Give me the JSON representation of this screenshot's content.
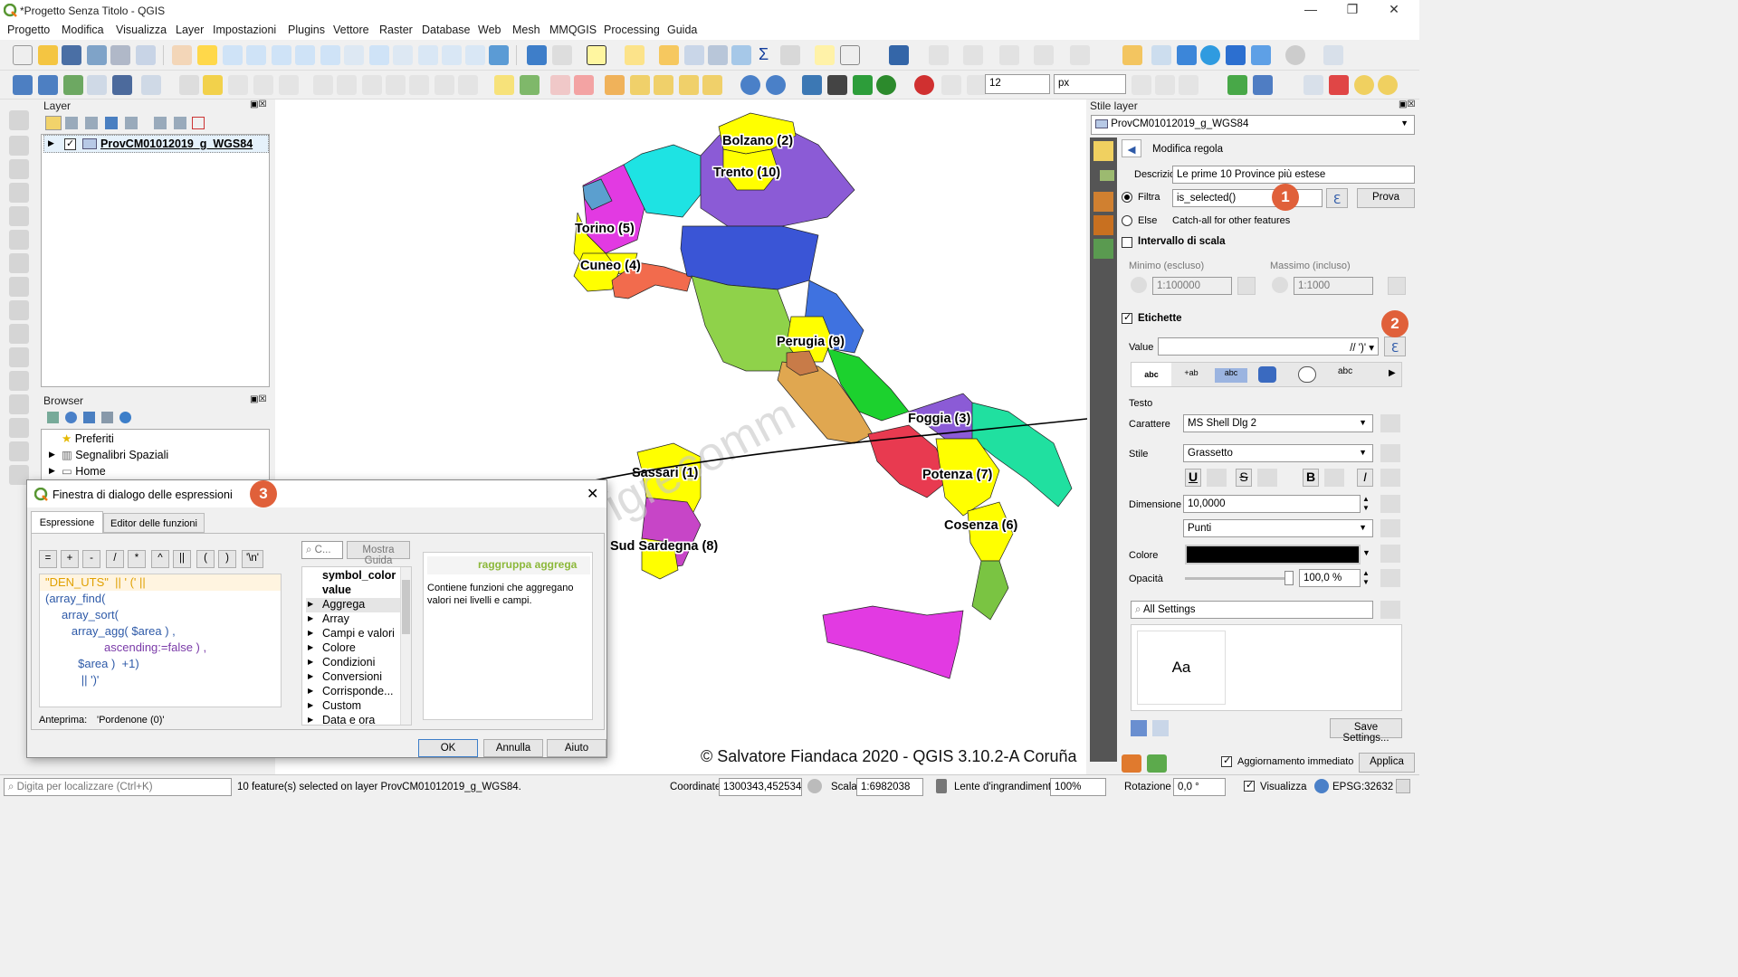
{
  "window": {
    "title": "*Progetto Senza Titolo - QGIS"
  },
  "menu": [
    "Progetto",
    "Modifica",
    "Visualizza",
    "Layer",
    "Impostazioni",
    "Plugins",
    "Vettore",
    "Raster",
    "Database",
    "Web",
    "Mesh",
    "MMQGIS",
    "Processing",
    "Guida"
  ],
  "toolbar2": {
    "size_value": "12",
    "size_unit": "px"
  },
  "layers_panel": {
    "title": "Layer",
    "layer_name": "ProvCM01012019_g_WGS84"
  },
  "browser_panel": {
    "title": "Browser",
    "items": [
      "Preferiti",
      "Segnalibri Spaziali",
      "Home"
    ]
  },
  "map": {
    "labels": [
      {
        "text": "Bolzano (2)"
      },
      {
        "text": "Trento (10)"
      },
      {
        "text": "Torino (5)"
      },
      {
        "text": "Cuneo (4)"
      },
      {
        "text": "Perugia (9)"
      },
      {
        "text": "Foggia (3)"
      },
      {
        "text": "Sassari (1)"
      },
      {
        "text": "Potenza (7)"
      },
      {
        "text": "Sud Sardegna (8)"
      },
      {
        "text": "Cosenza (6)"
      }
    ],
    "watermark": "Pigrecomm",
    "copyright": "© Salvatore Fiandaca 2020 - QGIS 3.10.2-A Coruña",
    "colors": {
      "yellow": "#ffff00",
      "cyan": "#1ee3e3",
      "purple": "#8b5bd6",
      "blue": "#3a55d6",
      "green": "#8fd24a",
      "red": "#e83a50",
      "magenta": "#e23ae2"
    }
  },
  "style_panel": {
    "title": "Stile layer",
    "layer": "ProvCM01012019_g_WGS84",
    "modifica_regola": "Modifica regola",
    "descrizione_label": "Descrizione",
    "descrizione_value": "Le prime 10 Province più estese",
    "filtra_label": "Filtra",
    "filtra_value": "is_selected()",
    "prova_button": "Prova",
    "else_label": "Else",
    "else_text": "Catch-all for other features",
    "intervallo_label": "Intervallo di scala",
    "minimo_label": "Minimo (escluso)",
    "massimo_label": "Massimo (incluso)",
    "minimo_value": "1:100000",
    "massimo_value": "1:1000",
    "etichette_label": "Etichette",
    "value_label": "Value",
    "value_text": "// ')'",
    "testo_label": "Testo",
    "carattere_label": "Carattere",
    "carattere_value": "MS Shell Dlg 2",
    "stile_label": "Stile",
    "stile_value": "Grassetto",
    "dimensione_label": "Dimensione",
    "dimensione_value": "10,0000",
    "unit_value": "Punti",
    "colore_label": "Colore",
    "opacita_label": "Opacità",
    "opacita_value": "100,0 %",
    "all_settings": "All Settings",
    "preview_text": "Aa",
    "save_settings": "Save Settings...",
    "aggiornamento": "Aggiornamento immediato",
    "applica": "Applica",
    "badges": [
      "1",
      "2",
      "3"
    ]
  },
  "dialog": {
    "title": "Finestra di dialogo delle espressioni",
    "tabs": [
      "Espressione",
      "Editor delle funzioni"
    ],
    "operators": [
      "=",
      "+",
      "-",
      "/",
      "*",
      "^",
      "||",
      "(",
      ")",
      "'\\n'"
    ],
    "code_lines": [
      "\"DEN_UTS\"  || ' (' ||",
      "(array_find(",
      "     array_sort(",
      "        array_agg( $area ) ,",
      "                  ascending:=false ) ,",
      "          $area )  +1)",
      "           || ')'"
    ],
    "anteprima_label": "Anteprima:",
    "anteprima_value": "'Pordenone (0)'",
    "search_placeholder": "C...",
    "mostra_guida": "Mostra Guida",
    "func_list": [
      "symbol_color",
      "value",
      "Aggrega",
      "Array",
      "Campi e valori",
      "Colore",
      "Condizioni",
      "Conversioni",
      "Corrisponde...",
      "Custom",
      "Data e ora"
    ],
    "help_title": "raggruppa aggrega",
    "help_text": "Contiene funzioni che aggregano valori nei livelli e campi.",
    "ok": "OK",
    "annulla": "Annulla",
    "aiuto": "Aiuto"
  },
  "status": {
    "search_placeholder": "Digita per localizzare (Ctrl+K)",
    "message": "10 feature(s) selected on layer ProvCM01012019_g_WGS84.",
    "coordinate_label": "Coordinate",
    "coordinate_value": "1300343,4525344",
    "scala_label": "Scala",
    "scala_value": "1:6982038",
    "lente_label": "Lente d'ingrandimento",
    "lente_value": "100%",
    "rotazione_label": "Rotazione",
    "rotazione_value": "0,0 °",
    "visualizza": "Visualizza",
    "epsg": "EPSG:32632"
  }
}
